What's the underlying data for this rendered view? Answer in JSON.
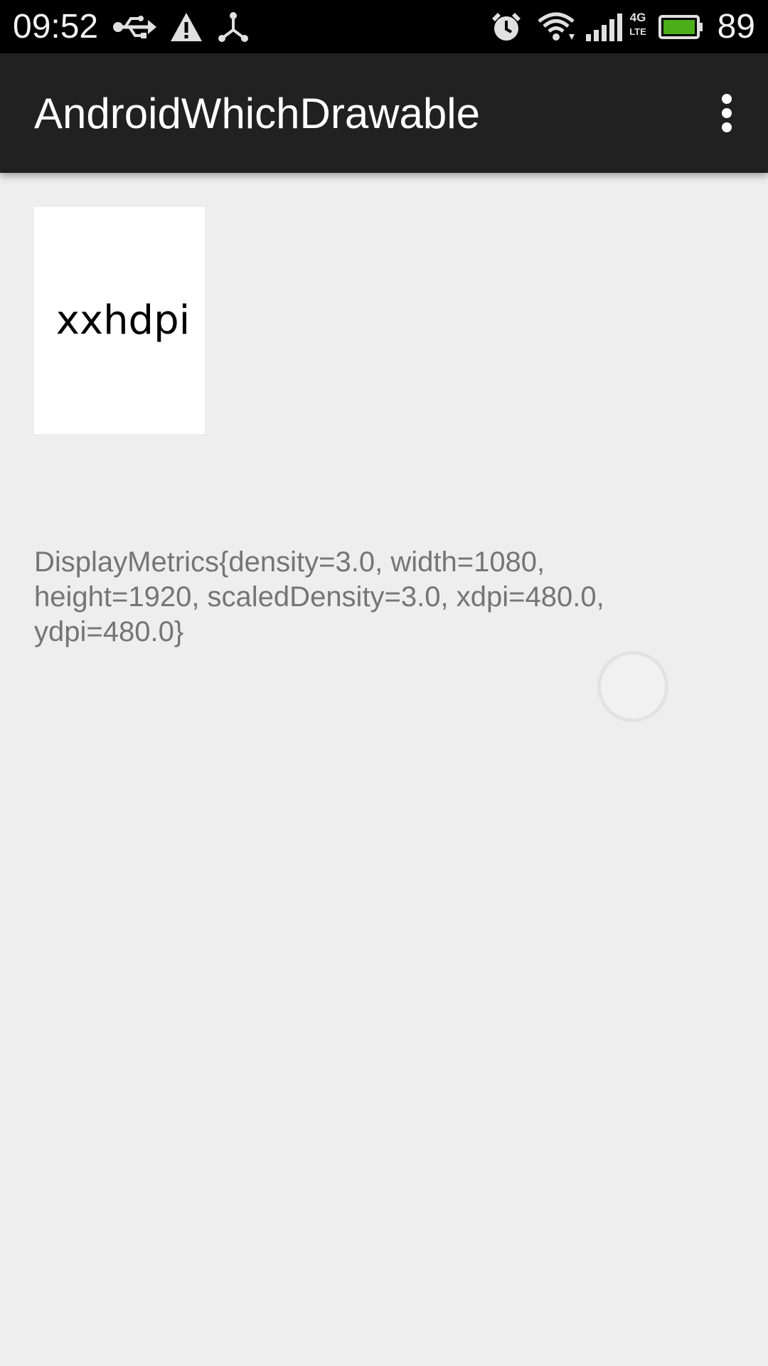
{
  "status_bar": {
    "time": "09:52",
    "battery_level": "89",
    "icons": [
      "usb-icon",
      "warning-icon",
      "debug-share-icon",
      "alarm-icon",
      "wifi-icon",
      "signal-icon",
      "network-4g-lte-icon",
      "battery-icon"
    ],
    "network_type": "4G",
    "network_sub": "LTE",
    "battery_color": "#4caf1a"
  },
  "app_bar": {
    "title": "AndroidWhichDrawable",
    "background": "#212121"
  },
  "content": {
    "drawable_label": "xxhdpi",
    "metrics": "DisplayMetrics{density=3.0, width=1080, height=1920, scaledDensity=3.0, xdpi=480.0, ydpi=480.0}"
  }
}
